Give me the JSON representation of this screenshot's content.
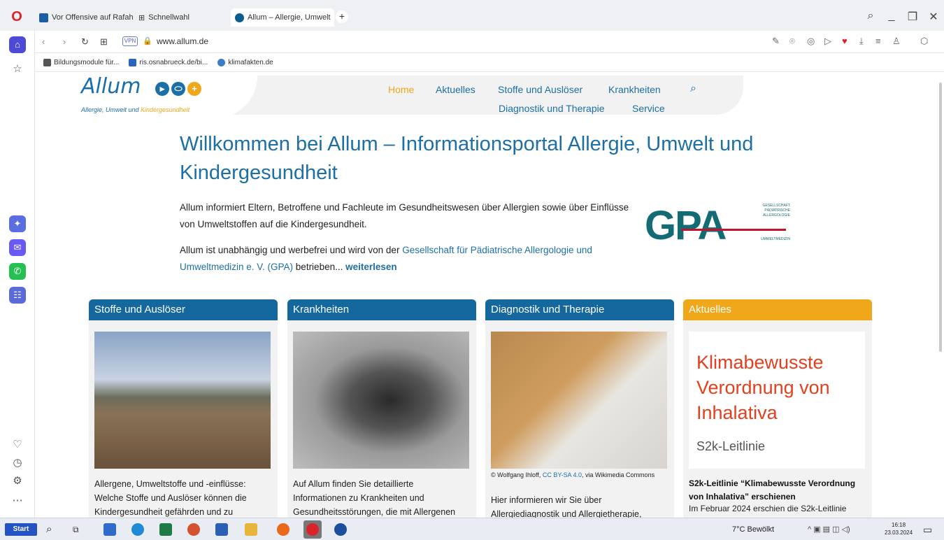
{
  "browser": {
    "tabs": [
      {
        "label": "Vor Offensive auf Rafah: \""
      },
      {
        "label": "Schnellwahl"
      },
      {
        "label": "Allum – Allergie, Umwelt"
      }
    ],
    "new_tab": "+",
    "url": "www.allum.de",
    "vpn": "VPN",
    "bookmarks": [
      {
        "label": "Bildungsmodule für..."
      },
      {
        "label": "ris.osnabrueck.de/bi..."
      },
      {
        "label": "klimafakten.de"
      }
    ]
  },
  "site": {
    "logo": {
      "name": "Allum",
      "sub_blue": "Allergie, Umwelt und ",
      "sub_orange": "Kindergesundheit"
    },
    "nav": {
      "home": "Home",
      "aktuelles": "Aktuelles",
      "stoffe": "Stoffe und Auslöser",
      "krankheiten": "Krankheiten",
      "diagnostik": "Diagnostik und Therapie",
      "service": "Service"
    },
    "welcome_title": "Willkommen bei Allum – Informationsportal Allergie, Umwelt und Kindergesundheit",
    "intro1": "Allum informiert Eltern, Betroffene und Fachleute im Gesundheitswesen über Allergien sowie über Einflüsse von Umweltstoffen auf die Kindergesundheit.",
    "intro2_start": "Allum ist unabhängig und werbefrei und wird von der ",
    "intro2_link": "Gesellschaft für Pädiatrische Allergologie und Umweltmedizin e. V. (GPA)",
    "intro2_end": " betrieben... ",
    "intro2_more": "weiterlesen",
    "gpa": {
      "letters": "GPA",
      "line1": "GESELLSCHAFT",
      "line2": "PÄDIATRISCHE",
      "line3": "ALLERGOLOGIE",
      "bottom": "UMWELTMEDIZIN"
    },
    "cards": [
      {
        "title": "Stoffe und Auslöser",
        "text": "Allergene, Umweltstoffe und -einflüsse: Welche Stoffe und Auslöser können die Kindergesundheit gefährden und zu"
      },
      {
        "title": "Krankheiten",
        "text": "Auf Allum finden Sie detaillierte Informationen zu Krankheiten und Gesundheitsstörungen, die mit Allergenen"
      },
      {
        "title": "Diagnostik und Therapie",
        "credit_pre": "© Wolfgang Ihloff, ",
        "credit_link": "CC BY-SA 4.0",
        "credit_post": ", via Wikimedia Commons",
        "text": "Hier informieren wir Sie über Allergiediagnostik und Allergietherapie,"
      },
      {
        "title": "Aktuelles",
        "news_title": "Klimabewusste Verordnung von Inhalativa",
        "news_sub": "S2k-Leitlinie",
        "news_head": "S2k-Leitlinie “Klimabewusste Verordnung von Inhalativa” erschienen",
        "news_more": "Im Februar 2024 erschien die S2k-Leitlinie"
      }
    ]
  },
  "taskbar": {
    "start": "Start",
    "weather": "7°C  Bewölkt",
    "time": "16:18",
    "date": "23.03.2024"
  },
  "colors": {
    "brand_blue": "#1d6fa5",
    "card_blue": "#15689e",
    "accent_orange": "#f1a71a",
    "news_red": "#e2401f"
  }
}
